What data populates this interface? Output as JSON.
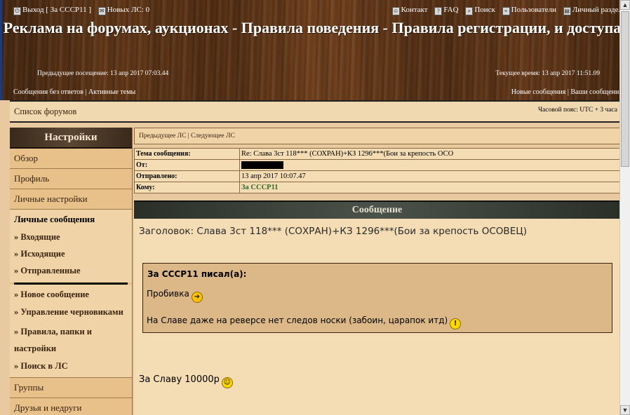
{
  "topnav": {
    "logout": "Выход [ За СССР11 ]",
    "new_pm": "Новых ЛС: 0",
    "contact": "Контакт",
    "faq": "FAQ",
    "search": "Поиск",
    "users": "Пользователи",
    "personal": "Личный раздел"
  },
  "site_title": "Реклама на форумах, аукционах - Правила поведения - Правила регистрации, и доступа",
  "visits": {
    "previous": "Предыдущее посещение: 13 апр 2017 07:03.44",
    "current": "Текущее время: 13 апр 2017 11:51.09"
  },
  "links": {
    "unanswered": "Сообщения без ответов",
    "active": "Активные темы",
    "new_posts": "Новые сообщения",
    "your_posts": "Ваши сообщения"
  },
  "forumbar": {
    "list": "Список форумов",
    "timezone": "Часовой пояс: UTC + 3 часа"
  },
  "sidebar": {
    "header": "Настройки",
    "items": [
      "Обзор",
      "Профиль",
      "Личные настройки"
    ],
    "pm_section": "Личные сообщения",
    "pm_items": [
      "» Входящие",
      "» Исходящие",
      "» Отправленные"
    ],
    "pm_items2": [
      "» Новое сообщение",
      "» Управление черновиками",
      "» Правила, папки и настройки",
      "» Поиск в ЛС"
    ],
    "bottom_items": [
      "Группы",
      "Друзья и недруги"
    ]
  },
  "pmnav": "Предыдущее ЛС | Следующее ЛС",
  "meta": {
    "subject_label": "Тема сообщения:",
    "subject_value": "Re: Слава 3ст 118*** (СОХРАН)+КЗ 1296***(Бои за крепость ОСО",
    "from_label": "От:",
    "sent_label": "Отправлено:",
    "sent_value": "13 апр 2017 10:07.47",
    "to_label": "Кому:",
    "to_value": "За СССР11"
  },
  "message": {
    "header": "Сообщение",
    "subject": "Заголовок: Слава 3ст 118*** (СОХРАН)+КЗ 1296***(Бои за крепость ОСОВЕЦ)",
    "quote_author": "За СССР11 писал(а):",
    "quote_line1": "Пробивка",
    "quote_line2": "На Славе даже на реверсе нет следов носки (забоин, царапок итд)",
    "reply": "За Славу 10000р"
  }
}
